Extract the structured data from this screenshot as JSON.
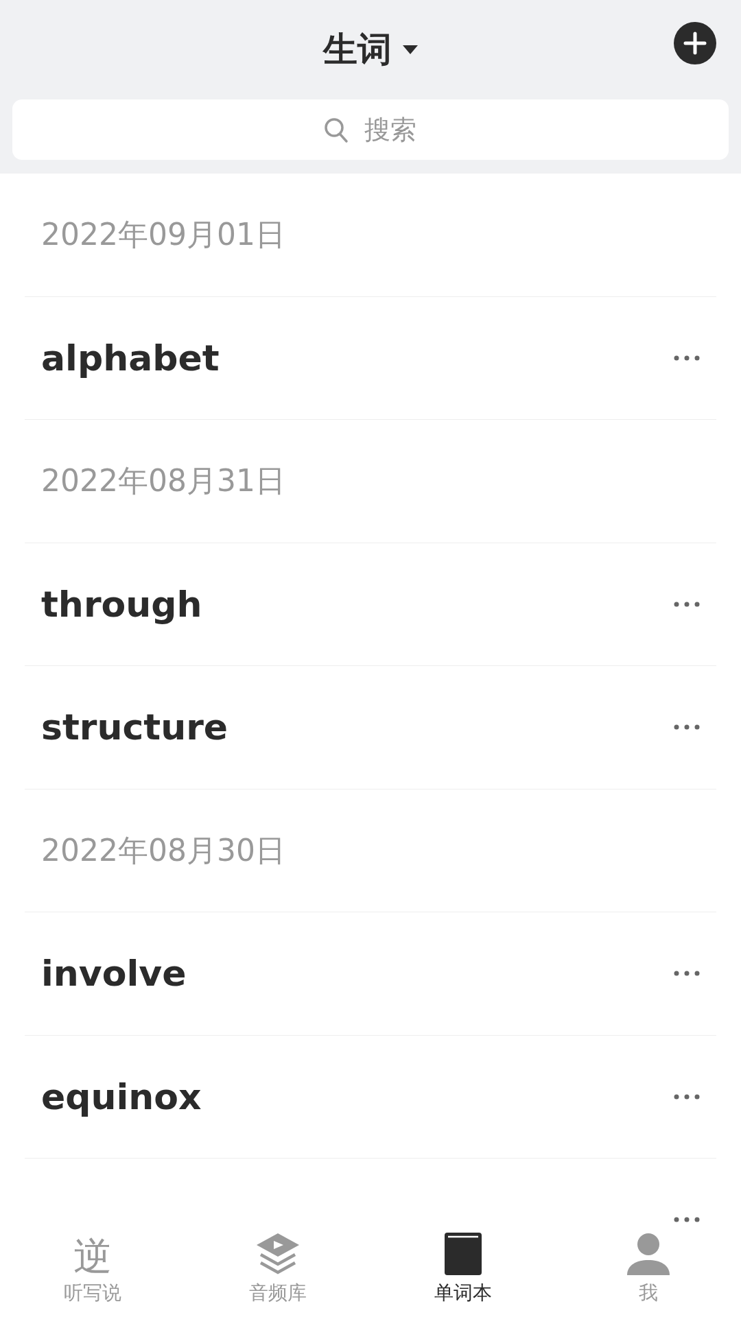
{
  "header": {
    "title": "生词",
    "search": {
      "placeholder": "搜索"
    }
  },
  "list": [
    {
      "kind": "date",
      "text": "2022年09月01日"
    },
    {
      "kind": "word",
      "text": "alphabet"
    },
    {
      "kind": "date",
      "text": "2022年08月31日"
    },
    {
      "kind": "word",
      "text": "through"
    },
    {
      "kind": "word",
      "text": "structure"
    },
    {
      "kind": "date",
      "text": "2022年08月30日"
    },
    {
      "kind": "word",
      "text": "involve"
    },
    {
      "kind": "word",
      "text": "equinox"
    },
    {
      "kind": "word_hidden"
    }
  ],
  "tab_bar": [
    {
      "kind": "glyph",
      "label": "听写说",
      "glyph": "逆",
      "selected": false
    },
    {
      "kind": "layers",
      "label": "音频库",
      "selected": false
    },
    {
      "kind": "book",
      "label": "单词本",
      "selected": true
    },
    {
      "kind": "person",
      "label": "我",
      "selected": false
    }
  ]
}
